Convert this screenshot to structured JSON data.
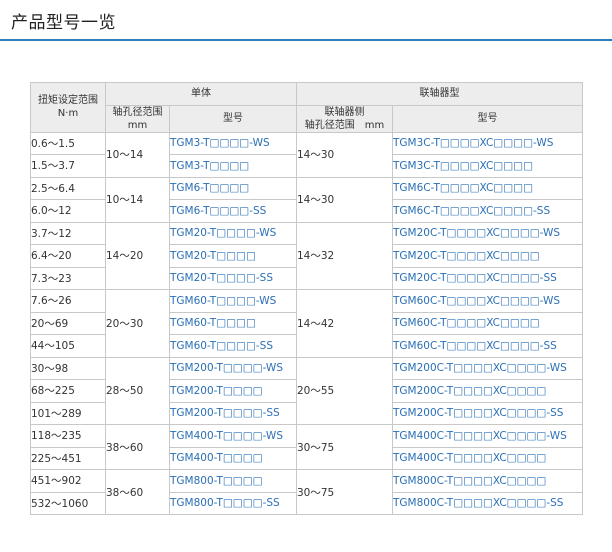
{
  "page": {
    "title": "产品型号一览"
  },
  "table": {
    "headers": {
      "torque_range": [
        "扭矩设定范围",
        "N·m"
      ],
      "single": "单体",
      "coupling": "联轴器型",
      "shaft_bore": [
        "轴孔径范围",
        "mm"
      ],
      "model": "型号",
      "coupling_bore": [
        "联轴器侧",
        "轴孔径范围　mm"
      ],
      "coupling_model": "型号"
    },
    "groups": [
      {
        "bore": "10～14",
        "coupling_bore": "14～30",
        "rows": [
          {
            "torque": "0.6～1.5",
            "model": "TGM3-T□□□□-WS",
            "coupling_model": "TGM3C-T□□□□XC□□□□-WS"
          },
          {
            "torque": "1.5～3.7",
            "model": "TGM3-T□□□□",
            "coupling_model": "TGM3C-T□□□□XC□□□□"
          }
        ]
      },
      {
        "bore": "10～14",
        "coupling_bore": "14～30",
        "rows": [
          {
            "torque": "2.5～6.4",
            "model": "TGM6-T□□□□",
            "coupling_model": "TGM6C-T□□□□XC□□□□"
          },
          {
            "torque": "6.0～12",
            "model": "TGM6-T□□□□-SS",
            "coupling_model": "TGM6C-T□□□□XC□□□□-SS"
          }
        ]
      },
      {
        "bore": "14～20",
        "coupling_bore": "14～32",
        "rows": [
          {
            "torque": "3.7～12",
            "model": "TGM20-T□□□□-WS",
            "coupling_model": "TGM20C-T□□□□XC□□□□-WS"
          },
          {
            "torque": "6.4～20",
            "model": "TGM20-T□□□□",
            "coupling_model": "TGM20C-T□□□□XC□□□□"
          },
          {
            "torque": "7.3～23",
            "model": "TGM20-T□□□□-SS",
            "coupling_model": "TGM20C-T□□□□XC□□□□-SS"
          }
        ]
      },
      {
        "bore": "20～30",
        "coupling_bore": "14～42",
        "rows": [
          {
            "torque": "7.6～26",
            "model": "TGM60-T□□□□-WS",
            "coupling_model": "TGM60C-T□□□□XC□□□□-WS"
          },
          {
            "torque": "20～69",
            "model": "TGM60-T□□□□",
            "coupling_model": "TGM60C-T□□□□XC□□□□"
          },
          {
            "torque": "44～105",
            "model": "TGM60-T□□□□-SS",
            "coupling_model": "TGM60C-T□□□□XC□□□□-SS"
          }
        ]
      },
      {
        "bore": "28～50",
        "coupling_bore": "20～55",
        "rows": [
          {
            "torque": "30～98",
            "model": "TGM200-T□□□□-WS",
            "coupling_model": "TGM200C-T□□□□XC□□□□-WS"
          },
          {
            "torque": "68～225",
            "model": "TGM200-T□□□□",
            "coupling_model": "TGM200C-T□□□□XC□□□□"
          },
          {
            "torque": "101～289",
            "model": "TGM200-T□□□□-SS",
            "coupling_model": "TGM200C-T□□□□XC□□□□-SS"
          }
        ]
      },
      {
        "bore": "38～60",
        "coupling_bore": "30～75",
        "rows": [
          {
            "torque": "118～235",
            "model": "TGM400-T□□□□-WS",
            "coupling_model": "TGM400C-T□□□□XC□□□□-WS"
          },
          {
            "torque": "225～451",
            "model": "TGM400-T□□□□",
            "coupling_model": "TGM400C-T□□□□XC□□□□"
          }
        ]
      },
      {
        "bore": "38～60",
        "coupling_bore": "30～75",
        "rows": [
          {
            "torque": "451～902",
            "model": "TGM800-T□□□□",
            "coupling_model": "TGM800C-T□□□□XC□□□□"
          },
          {
            "torque": "532～1060",
            "model": "TGM800-T□□□□-SS",
            "coupling_model": "TGM800C-T□□□□XC□□□□-SS"
          }
        ]
      }
    ]
  },
  "colors": {
    "accent_rule": "#2b7fc3",
    "header_bg": "#ededed",
    "grid_border": "#c8c8c8",
    "model_text": "#2a5d97"
  }
}
